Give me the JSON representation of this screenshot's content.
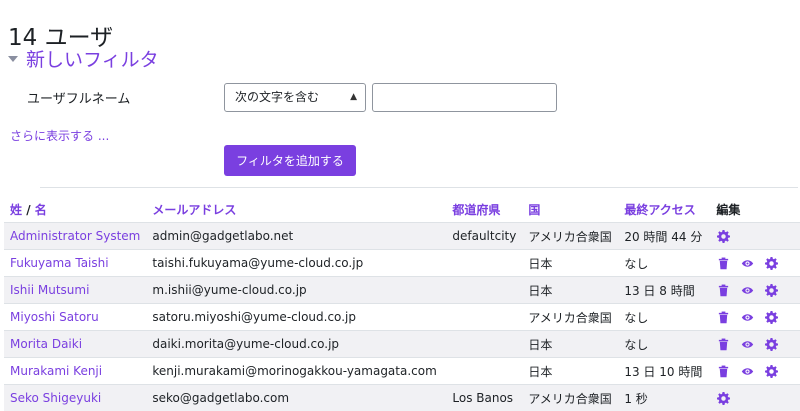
{
  "page": {
    "title": "14 ユーザ"
  },
  "filter": {
    "header": "新しいフィルタ",
    "field_label": "ユーザフルネーム",
    "operator_selected": "次の文字を含む",
    "value": "",
    "show_more": "さらに表示する ...",
    "add_button": "フィルタを追加する"
  },
  "table": {
    "headers": {
      "surname": "姓",
      "sep": "/",
      "given": "名",
      "email": "メールアドレス",
      "prefecture": "都道府県",
      "country": "国",
      "last_access": "最終アクセス",
      "edit": "編集"
    },
    "rows": [
      {
        "name": "Administrator System",
        "email": "admin@gadgetlabo.net",
        "prefecture": "defaultcity",
        "country": "アメリカ合衆国",
        "last_access": "20 時間 44 分"
      },
      {
        "name": "Fukuyama Taishi",
        "email": "taishi.fukuyama@yume-cloud.co.jp",
        "prefecture": "",
        "country": "日本",
        "last_access": "なし"
      },
      {
        "name": "Ishii Mutsumi",
        "email": "m.ishii@yume-cloud.co.jp",
        "prefecture": "",
        "country": "日本",
        "last_access": "13 日 8 時間"
      },
      {
        "name": "Miyoshi Satoru",
        "email": "satoru.miyoshi@yume-cloud.co.jp",
        "prefecture": "",
        "country": "アメリカ合衆国",
        "last_access": "なし"
      },
      {
        "name": "Morita Daiki",
        "email": "daiki.morita@yume-cloud.co.jp",
        "prefecture": "",
        "country": "日本",
        "last_access": "なし"
      },
      {
        "name": "Murakami Kenji",
        "email": "kenji.murakami@morinogakkou-yamagata.com",
        "prefecture": "",
        "country": "日本",
        "last_access": "13 日 10 時間"
      },
      {
        "name": "Seko Shigeyuki",
        "email": "seko@gadgetlabo.com",
        "prefecture": "Los Banos",
        "country": "アメリカ合衆国",
        "last_access": "1 秒"
      }
    ]
  },
  "colors": {
    "accent": "#7a3fe0",
    "stripe": "#f1f1f4",
    "border": "#dee2e6"
  },
  "icons": [
    "trash-icon",
    "eye-icon",
    "gear-icon"
  ]
}
